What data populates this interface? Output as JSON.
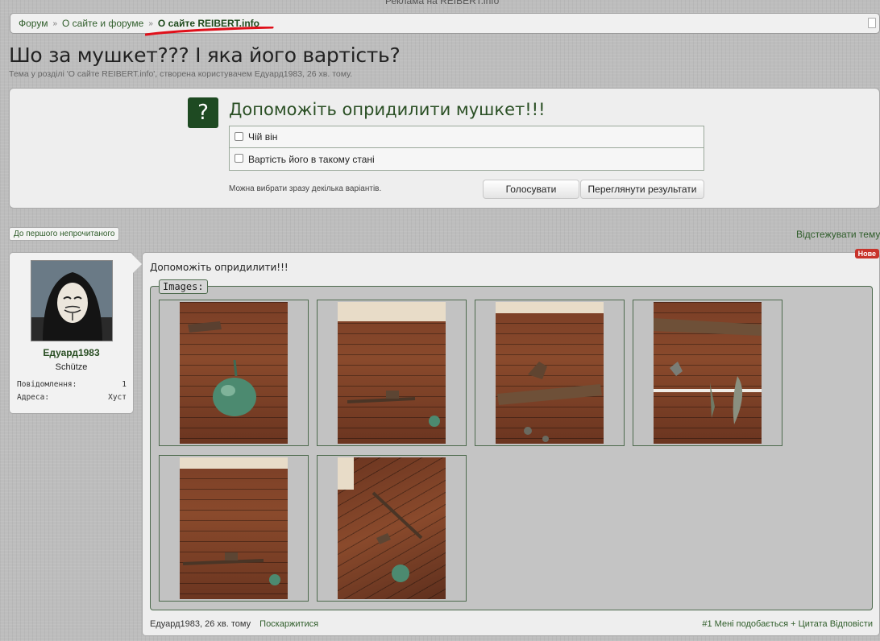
{
  "top_text": "Реклама на REIBERT.info",
  "breadcrumb": {
    "items": [
      "Форум",
      "О сайте и форуме",
      "О сайте REIBERT.info"
    ],
    "separator": "»"
  },
  "thread": {
    "title": "Шо за мушкет??? І яка його вартість?",
    "description": "Тема у розділі 'О сайте REIBERT.info', створена користувачем Едуард1983, 26 хв. тому."
  },
  "poll": {
    "icon": "?",
    "question": "Допоможіть опридилити мушкет!!!",
    "options": [
      "Чій він",
      "Вартість його в такому стані"
    ],
    "hint": "Можна вибрати зразу декілька варіантів.",
    "vote_button": "Голосувати",
    "results_button": "Переглянути результати"
  },
  "navigation": {
    "first_unread": "До першого непрочитаного",
    "watch_thread": "Відстежувати тему"
  },
  "user": {
    "name": "Едуард1983",
    "title": "Schütze",
    "messages_label": "Повідомлення:",
    "messages_value": "1",
    "address_label": "Адреса:",
    "address_value": "Хуст"
  },
  "post": {
    "badge": "Нове",
    "text": "Допоможіть опридилити!!!",
    "images_legend": "Images:",
    "images": [
      "photo-1",
      "photo-2",
      "photo-3",
      "photo-4",
      "photo-5",
      "photo-6"
    ],
    "footer": {
      "author_time": "Едуард1983, 26 хв. тому",
      "report": "Поскаржитися",
      "number": "#1",
      "like": "Мені подобається",
      "quote": "+ Цитата",
      "reply": "Відповісти"
    }
  },
  "colors": {
    "accent": "#2f5d2a",
    "poll_icon_bg": "#1e4a22",
    "badge_red": "#c8332b",
    "annotation_red": "#e0101a"
  }
}
